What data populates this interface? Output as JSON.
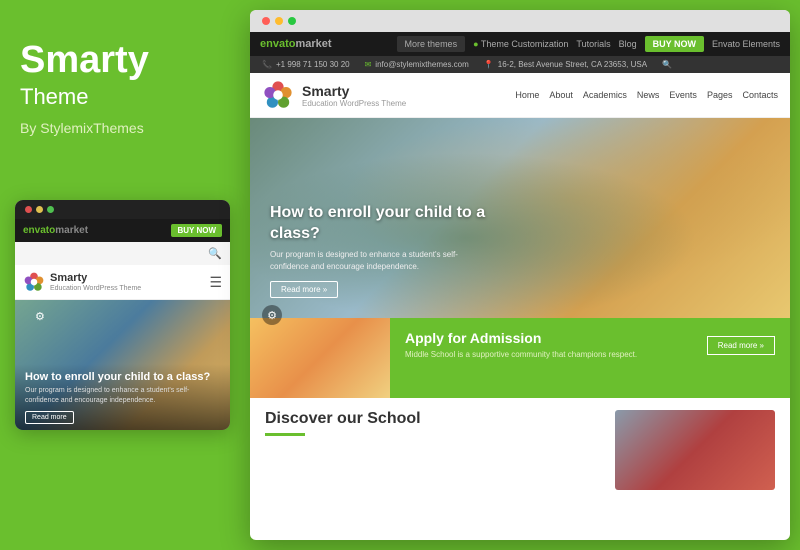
{
  "left": {
    "title": "Smarty",
    "subtitle": "Theme",
    "author": "By StylemixThemes"
  },
  "mobile_card": {
    "dots": [
      "red",
      "yellow",
      "green"
    ],
    "envato_logo": "envato market",
    "buy_now": "BUY NOW",
    "site_name": "Smarty",
    "site_tagline": "Education WordPress Theme",
    "hero_title": "How to enroll your child to a class?",
    "hero_text": "Our program is designed to enhance a student's self-confidence and encourage independence.",
    "read_more": "Read more"
  },
  "desktop": {
    "browser_dots": [
      "r",
      "y",
      "g"
    ],
    "envato_bar": {
      "logo": "envato market",
      "more_themes": "More themes",
      "theme_customization": "Theme Customization",
      "tutorials": "Tutorials",
      "blog": "Blog",
      "buy_now": "BUY NOW",
      "envato_elements": "Envato Elements"
    },
    "site_top_bar": {
      "phone": "+1 998 71 150 30 20",
      "email": "info@stylemixthemes.com",
      "address": "16-2, Best Avenue Street, CA 23653, USA"
    },
    "site_nav": {
      "logo": "Smarty",
      "tagline": "Education WordPress Theme",
      "links": [
        "Home",
        "About",
        "Academics",
        "News",
        "Events",
        "Pages",
        "Contacts"
      ]
    },
    "hero": {
      "title": "How to enroll your child to a class?",
      "text": "Our program is designed to enhance a student's self-confidence and encourage independence.",
      "btn": "Read more »"
    },
    "admission": {
      "title": "Apply for Admission",
      "text": "Middle School is a supportive community that champions respect.",
      "btn": "Read more »"
    },
    "discover": {
      "title": "Discover our School"
    }
  },
  "colors": {
    "green": "#6abf2e",
    "dark": "#1a1a1a",
    "text": "#333"
  }
}
